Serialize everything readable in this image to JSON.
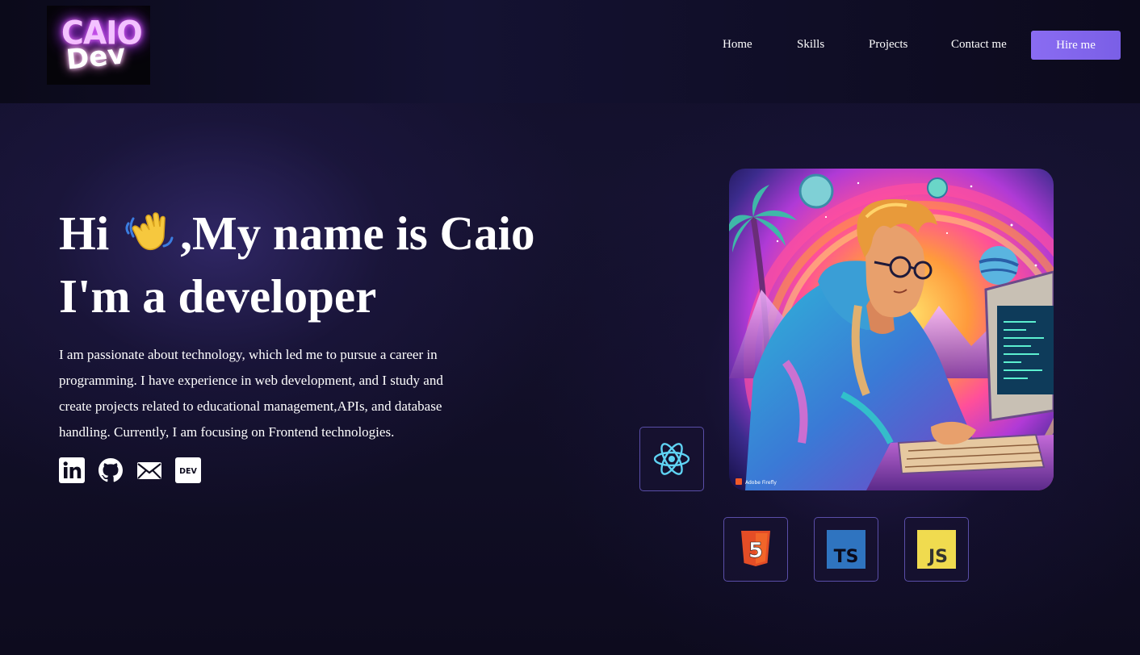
{
  "logo": {
    "line1": "CAIO",
    "line2": "Dev"
  },
  "nav": {
    "items": [
      {
        "label": "Home"
      },
      {
        "label": "Skills"
      },
      {
        "label": "Projects"
      },
      {
        "label": "Contact me"
      }
    ],
    "hire_label": "Hire me"
  },
  "hero": {
    "greeting_start": "Hi",
    "greeting_end": ",My name is Caio",
    "line2": "I'm a developer",
    "description": "I am passionate about technology, which led me to pursue a career in programming. I have experience in web development, and I study and create projects related to educational management,APIs, and database handling. Currently, I am focusing on Frontend technologies.",
    "wave_icon": "waving-hand-icon"
  },
  "socials": [
    {
      "icon": "linkedin-icon"
    },
    {
      "icon": "github-icon"
    },
    {
      "icon": "mail-icon"
    },
    {
      "icon": "dev-to-icon",
      "label": "DEV"
    }
  ],
  "portrait": {
    "watermark": "Adobe Firefly"
  },
  "tech_stack": [
    {
      "icon": "react-icon"
    },
    {
      "icon": "html5-icon",
      "label": "5"
    },
    {
      "icon": "typescript-icon",
      "label": "TS"
    },
    {
      "icon": "javascript-icon",
      "label": "JS"
    }
  ],
  "colors": {
    "accent": "#7a5fe6",
    "background": "#0d0b1e",
    "card_border": "#5a4ea8"
  }
}
